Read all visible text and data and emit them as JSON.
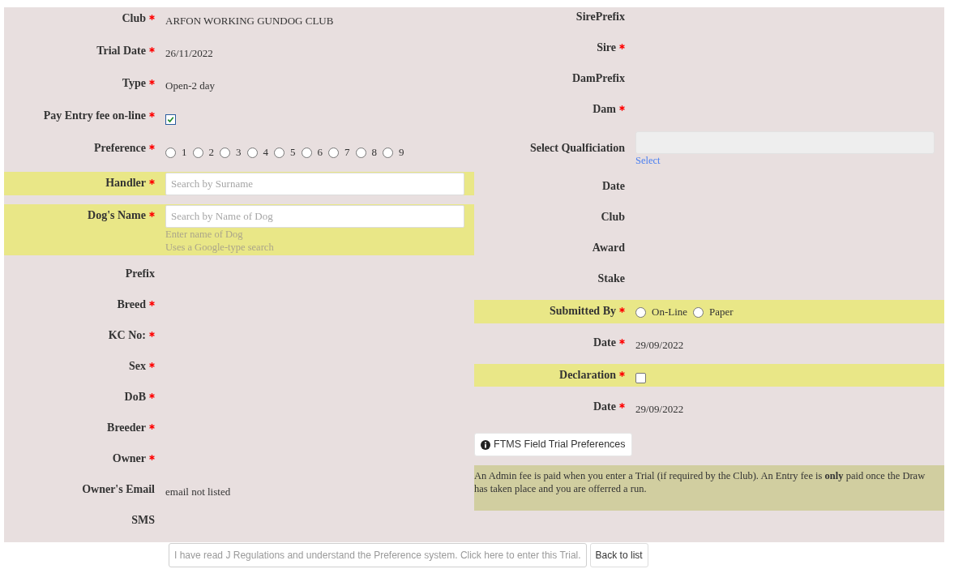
{
  "left_fields": [
    {
      "kind": "text",
      "label": "Club",
      "required": true,
      "highlighted": false,
      "value": "ARFON WORKING GUNDOG CLUB"
    },
    {
      "kind": "text",
      "label": "Trial Date",
      "required": true,
      "highlighted": false,
      "value": "26/11/2022"
    },
    {
      "kind": "text",
      "label": "Type",
      "required": true,
      "highlighted": false,
      "value": "Open-2 day"
    },
    {
      "kind": "checkbox",
      "label": "Pay Entry fee on-line",
      "required": true,
      "highlighted": false,
      "checked": true
    },
    {
      "kind": "radio_group",
      "label": "Preference",
      "required": true,
      "highlighted": false,
      "options": [
        {
          "label": "1",
          "selected": false
        },
        {
          "label": "2",
          "selected": false
        },
        {
          "label": "3",
          "selected": false
        },
        {
          "label": "4",
          "selected": false
        },
        {
          "label": "5",
          "selected": false
        },
        {
          "label": "6",
          "selected": false
        },
        {
          "label": "7",
          "selected": false
        },
        {
          "label": "8",
          "selected": false
        },
        {
          "label": "9",
          "selected": false
        }
      ]
    },
    {
      "kind": "search",
      "label": "Handler",
      "required": true,
      "highlighted": true,
      "placeholder": "Search by Surname"
    },
    {
      "kind": "search",
      "label": "Dog's Name",
      "required": true,
      "highlighted": true,
      "placeholder": "Search by Name of Dog",
      "hints": [
        "Enter name of Dog",
        "Uses a Google-type search"
      ]
    },
    {
      "kind": "text",
      "label": "Prefix",
      "required": false,
      "highlighted": false
    },
    {
      "kind": "text",
      "label": "Breed",
      "required": true,
      "highlighted": false
    },
    {
      "kind": "text",
      "label": "KC No:",
      "required": true,
      "highlighted": false
    },
    {
      "kind": "text",
      "label": "Sex",
      "required": true,
      "highlighted": false
    },
    {
      "kind": "text",
      "label": "DoB",
      "required": true,
      "highlighted": false
    },
    {
      "kind": "text",
      "label": "Breeder",
      "required": true,
      "highlighted": false
    },
    {
      "kind": "text",
      "label": "Owner",
      "required": true,
      "highlighted": false
    },
    {
      "kind": "text",
      "label": "Owner's Email",
      "required": false,
      "highlighted": false,
      "value": "email not listed"
    },
    {
      "kind": "text",
      "label": "SMS",
      "required": false,
      "highlighted": false
    }
  ],
  "right_fields": [
    {
      "kind": "text",
      "label": "SirePrefix",
      "required": false,
      "highlighted": false
    },
    {
      "kind": "text",
      "label": "Sire",
      "required": true,
      "highlighted": false
    },
    {
      "kind": "text",
      "label": "DamPrefix",
      "required": false,
      "highlighted": false
    },
    {
      "kind": "text",
      "label": "Dam",
      "required": true,
      "highlighted": false
    },
    {
      "kind": "select",
      "label": "Select Qualficiation",
      "required": false,
      "highlighted": false,
      "link": "Select"
    },
    {
      "kind": "text",
      "label": "Date",
      "required": false,
      "highlighted": false
    },
    {
      "kind": "text",
      "label": "Club",
      "required": false,
      "highlighted": false
    },
    {
      "kind": "text",
      "label": "Award",
      "required": false,
      "highlighted": false
    },
    {
      "kind": "text",
      "label": "Stake",
      "required": false,
      "highlighted": false
    },
    {
      "kind": "radio_group",
      "label": "Submitted By",
      "required": true,
      "highlighted": true,
      "options": [
        {
          "label": "On-Line",
          "selected": false
        },
        {
          "label": "Paper",
          "selected": false
        }
      ]
    },
    {
      "kind": "text",
      "label": "Date",
      "required": true,
      "highlighted": false,
      "value": "29/09/2022"
    },
    {
      "kind": "checkbox",
      "label": "Declaration",
      "required": true,
      "highlighted": true,
      "checked": false
    },
    {
      "kind": "text",
      "label": "Date",
      "required": true,
      "highlighted": false,
      "value": "29/09/2022"
    }
  ],
  "info_button": {
    "label": "FTMS Field Trial Preferences"
  },
  "note": "An Admin fee is paid when you enter a Trial (if required by the Club). An Entry fee is **only** paid once the Draw has taken place and you are offerred a run.",
  "footer_buttons": [
    {
      "label": "I have read J Regulations and understand the Preference system. Click here to enter this Trial.",
      "disabled": true
    },
    {
      "label": "Back to list",
      "disabled": false
    }
  ]
}
